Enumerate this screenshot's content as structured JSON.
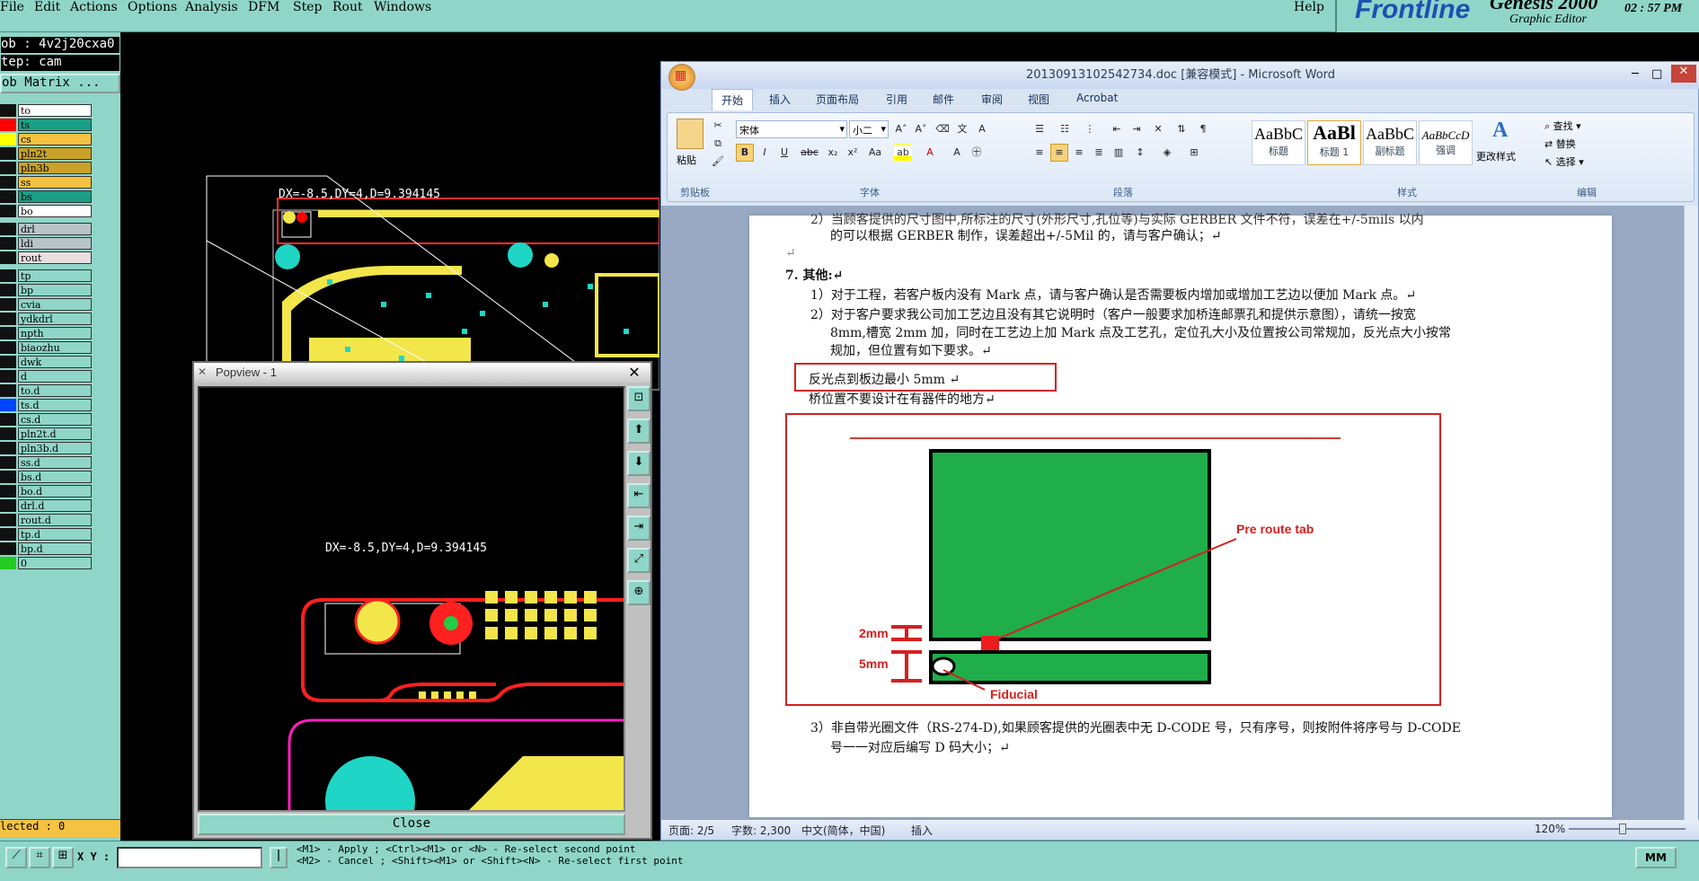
{
  "menu": [
    "File",
    "Edit",
    "Actions",
    "Options",
    "Analysis",
    "DFM",
    "Step",
    "Rout",
    "Windows"
  ],
  "help": "Help",
  "brand": {
    "name": "Frontline",
    "product": "Genesis 2000",
    "edition": "Graphic Editor",
    "time": "02 : 57  PM",
    "color": "#1e4fb4"
  },
  "job": {
    "name": "ob : 4v2j20cxa0",
    "step": "tep: cam",
    "matrix": "ob Matrix ..."
  },
  "layers": [
    {
      "n": "to",
      "c": "#ffffff",
      "s": "#111111"
    },
    {
      "n": "ts",
      "c": "#1b9e85",
      "s": "#ff0000"
    },
    {
      "n": "cs",
      "c": "#f5c242",
      "s": "#ffff00"
    },
    {
      "n": "pln2t",
      "c": "#c9a227",
      "s": "#111111"
    },
    {
      "n": "pln3b",
      "c": "#c9a227",
      "s": "#111111"
    },
    {
      "n": "ss",
      "c": "#f5c242",
      "s": "#111111"
    },
    {
      "n": "bs",
      "c": "#1b9e85",
      "s": "#111111"
    },
    {
      "n": "bo",
      "c": "#ffffff",
      "s": "#111111"
    },
    {
      "n": "drl",
      "c": "#b8c4c8",
      "s": "#111111"
    },
    {
      "n": "ldi",
      "c": "#b8c4c8",
      "s": "#111111"
    },
    {
      "n": "rout",
      "c": "#e8e0e0",
      "s": "#111111"
    },
    {
      "n": "tp",
      "c": "#8fd6c8",
      "s": "#111111"
    },
    {
      "n": "bp",
      "c": "#8fd6c8",
      "s": "#111111"
    },
    {
      "n": "cvia",
      "c": "#8fd6c8",
      "s": "#111111"
    },
    {
      "n": "ydkdrl",
      "c": "#8fd6c8",
      "s": "#111111"
    },
    {
      "n": "npth",
      "c": "#8fd6c8",
      "s": "#111111"
    },
    {
      "n": "biaozhu",
      "c": "#8fd6c8",
      "s": "#111111"
    },
    {
      "n": "dwk",
      "c": "#8fd6c8",
      "s": "#111111"
    },
    {
      "n": "d",
      "c": "#8fd6c8",
      "s": "#111111"
    },
    {
      "n": "to.d",
      "c": "#8fd6c8",
      "s": "#111111"
    },
    {
      "n": "ts.d",
      "c": "#8fd6c8",
      "s": "#0044ff"
    },
    {
      "n": "cs.d",
      "c": "#8fd6c8",
      "s": "#111111"
    },
    {
      "n": "pln2t.d",
      "c": "#8fd6c8",
      "s": "#111111"
    },
    {
      "n": "pln3b.d",
      "c": "#8fd6c8",
      "s": "#111111"
    },
    {
      "n": "ss.d",
      "c": "#8fd6c8",
      "s": "#111111"
    },
    {
      "n": "bs.d",
      "c": "#8fd6c8",
      "s": "#111111"
    },
    {
      "n": "bo.d",
      "c": "#8fd6c8",
      "s": "#111111"
    },
    {
      "n": "drl.d",
      "c": "#8fd6c8",
      "s": "#111111"
    },
    {
      "n": "rout.d",
      "c": "#8fd6c8",
      "s": "#111111"
    },
    {
      "n": "tp.d",
      "c": "#8fd6c8",
      "s": "#111111"
    },
    {
      "n": "bp.d",
      "c": "#8fd6c8",
      "s": "#111111"
    },
    {
      "n": "0",
      "c": "#8fd6c8",
      "s": "#22cc22"
    }
  ],
  "selected": "lected : 0",
  "measure": "DX=-8.5,DY=4,D=9.394145",
  "popview": {
    "title": "Popview - 1",
    "measure": "DX=-8.5,DY=4,D=9.394145",
    "close": "Close"
  },
  "status": {
    "xy": "X Y :",
    "hint1": "<M1> - Apply  ; <Ctrl><M1> or <N> - Re-select second point",
    "hint2": "<M2> - Cancel ; <Shift><M1> or <Shift><N> - Re-select first point",
    "units": "MM"
  },
  "word": {
    "title": "20130913102542734.doc [兼容模式] - Microsoft Word",
    "tabs": [
      "开始",
      "插入",
      "页面布局",
      "引用",
      "邮件",
      "审阅",
      "视图",
      "Acrobat"
    ],
    "font": "宋体",
    "size": "小二",
    "groups": [
      "剪贴板",
      "字体",
      "段落",
      "样式",
      "编辑"
    ],
    "paste": "粘贴",
    "styles": [
      {
        "p": "AaBbC",
        "n": "标题"
      },
      {
        "p": "AaBl",
        "n": "标题 1"
      },
      {
        "p": "AaBbC",
        "n": "副标题"
      },
      {
        "p": "AaBbCcD",
        "n": "强调"
      }
    ],
    "change_style": "更改样式",
    "edit": [
      "查找 ▾",
      "替换",
      "选择 ▾"
    ],
    "lines": [
      "2）当顾客提供的尺寸图中,所标注的尺寸(外形尺寸,孔位等)与实际 GERBER 文件不符，误差在+/-5mils 以内",
      "的可以根据 GERBER 制作，误差超出+/-5Mil 的，请与客户确认；↵",
      "↵",
      "7.   其他:↵",
      "1）对于工程，若客户板内没有 Mark 点，请与客户确认是否需要板内增加或增加工艺边以便加 Mark 点。↵",
      "2）对于客户要求我公司加工艺边且没有其它说明时（客户一般要求加桥连邮票孔和提供示意图），请统一按宽",
      "8mm,槽宽 2mm 加，同时在工艺边上加 Mark 点及工艺孔，定位孔大小及位置按公司常规加，反光点大小按常",
      "规加，但位置有如下要求。↵",
      "反光点到板边最小 5mm ↵",
      "桥位置不要设计在有器件的地方↵",
      "3）非自带光圈文件（RS-274-D),如果顾客提供的光圈表中无 D-CODE 号，只有序号，则按附件将序号与 D-CODE",
      "号一一对应后编写 D 码大小；↵"
    ],
    "diagram": {
      "pre_route_tab": "Pre route tab",
      "dim1": "2mm",
      "dim2": "5mm",
      "fiducial": "Fiducial"
    },
    "statusbar": {
      "page": "页面: 2/5",
      "words": "字数: 2,300",
      "lang": "中文(简体，中国)",
      "insert": "插入",
      "zoom": "120%"
    }
  }
}
